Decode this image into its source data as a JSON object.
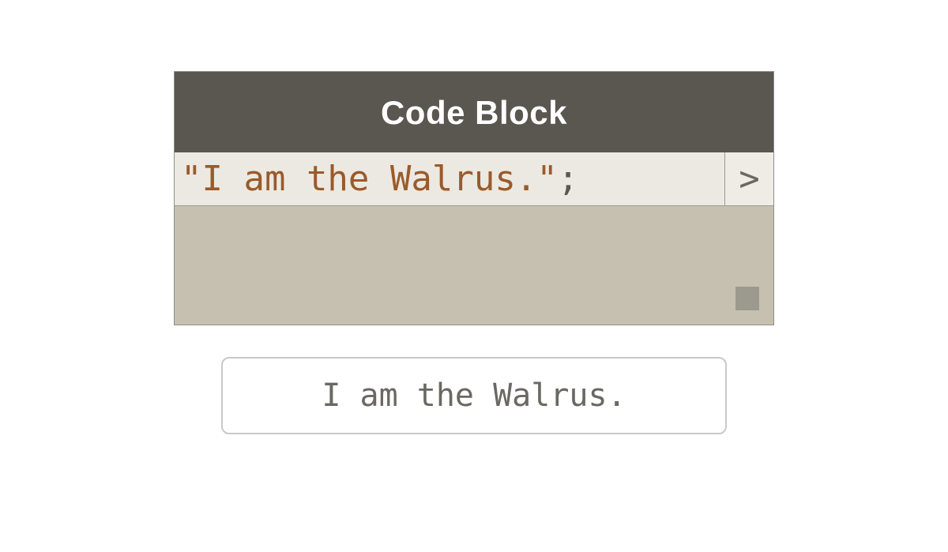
{
  "panel": {
    "title": "Code Block",
    "code_string": "\"I am the Walrus.\"",
    "code_semicolon": ";",
    "run_glyph": ">",
    "colors": {
      "header_bg": "#5a5650",
      "body_bg": "#c6c0b0",
      "input_bg": "#ece9e2",
      "string_fg": "#9a5a2a"
    }
  },
  "output": {
    "text": "I am the Walrus."
  }
}
